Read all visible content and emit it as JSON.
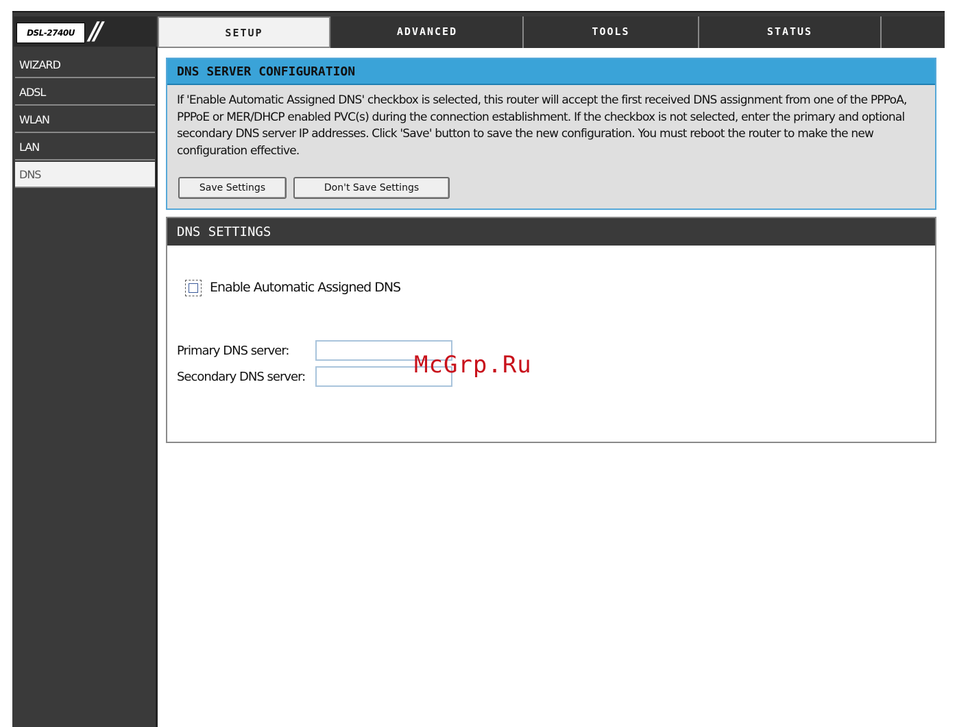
{
  "header": {
    "model": "DSL-2740U",
    "tabs": [
      {
        "label": "SETUP",
        "active": true
      },
      {
        "label": "ADVANCED",
        "active": false
      },
      {
        "label": "TOOLS",
        "active": false
      },
      {
        "label": "STATUS",
        "active": false
      }
    ]
  },
  "sidebar": {
    "items": [
      {
        "label": "WIZARD",
        "active": false
      },
      {
        "label": "ADSL",
        "active": false
      },
      {
        "label": "WLAN",
        "active": false
      },
      {
        "label": "LAN",
        "active": false
      },
      {
        "label": "DNS",
        "active": true
      }
    ]
  },
  "config": {
    "title": "DNS SERVER CONFIGURATION",
    "description": "If 'Enable Automatic Assigned DNS' checkbox is selected, this router will accept the first received DNS assignment from one of the PPPoA, PPPoE or MER/DHCP enabled PVC(s) during the connection establishment. If the checkbox is not selected, enter the primary and optional secondary DNS server IP addresses. Click 'Save' button to save the new configuration. You must reboot the router to make the new configuration effective.",
    "save_label": "Save Settings",
    "dont_save_label": "Don't Save Settings"
  },
  "settings": {
    "title": "DNS SETTINGS",
    "auto_dns_label": "Enable Automatic Assigned DNS",
    "auto_dns_checked": false,
    "primary_label": "Primary DNS server:",
    "primary_value": "",
    "secondary_label": "Secondary DNS server:",
    "secondary_value": ""
  },
  "watermark": "McGrp.Ru",
  "colors": {
    "accent": "#3aa3d8",
    "dark": "#3a3a3a",
    "panel": "#dfdfdf",
    "watermark": "#c8111b"
  }
}
